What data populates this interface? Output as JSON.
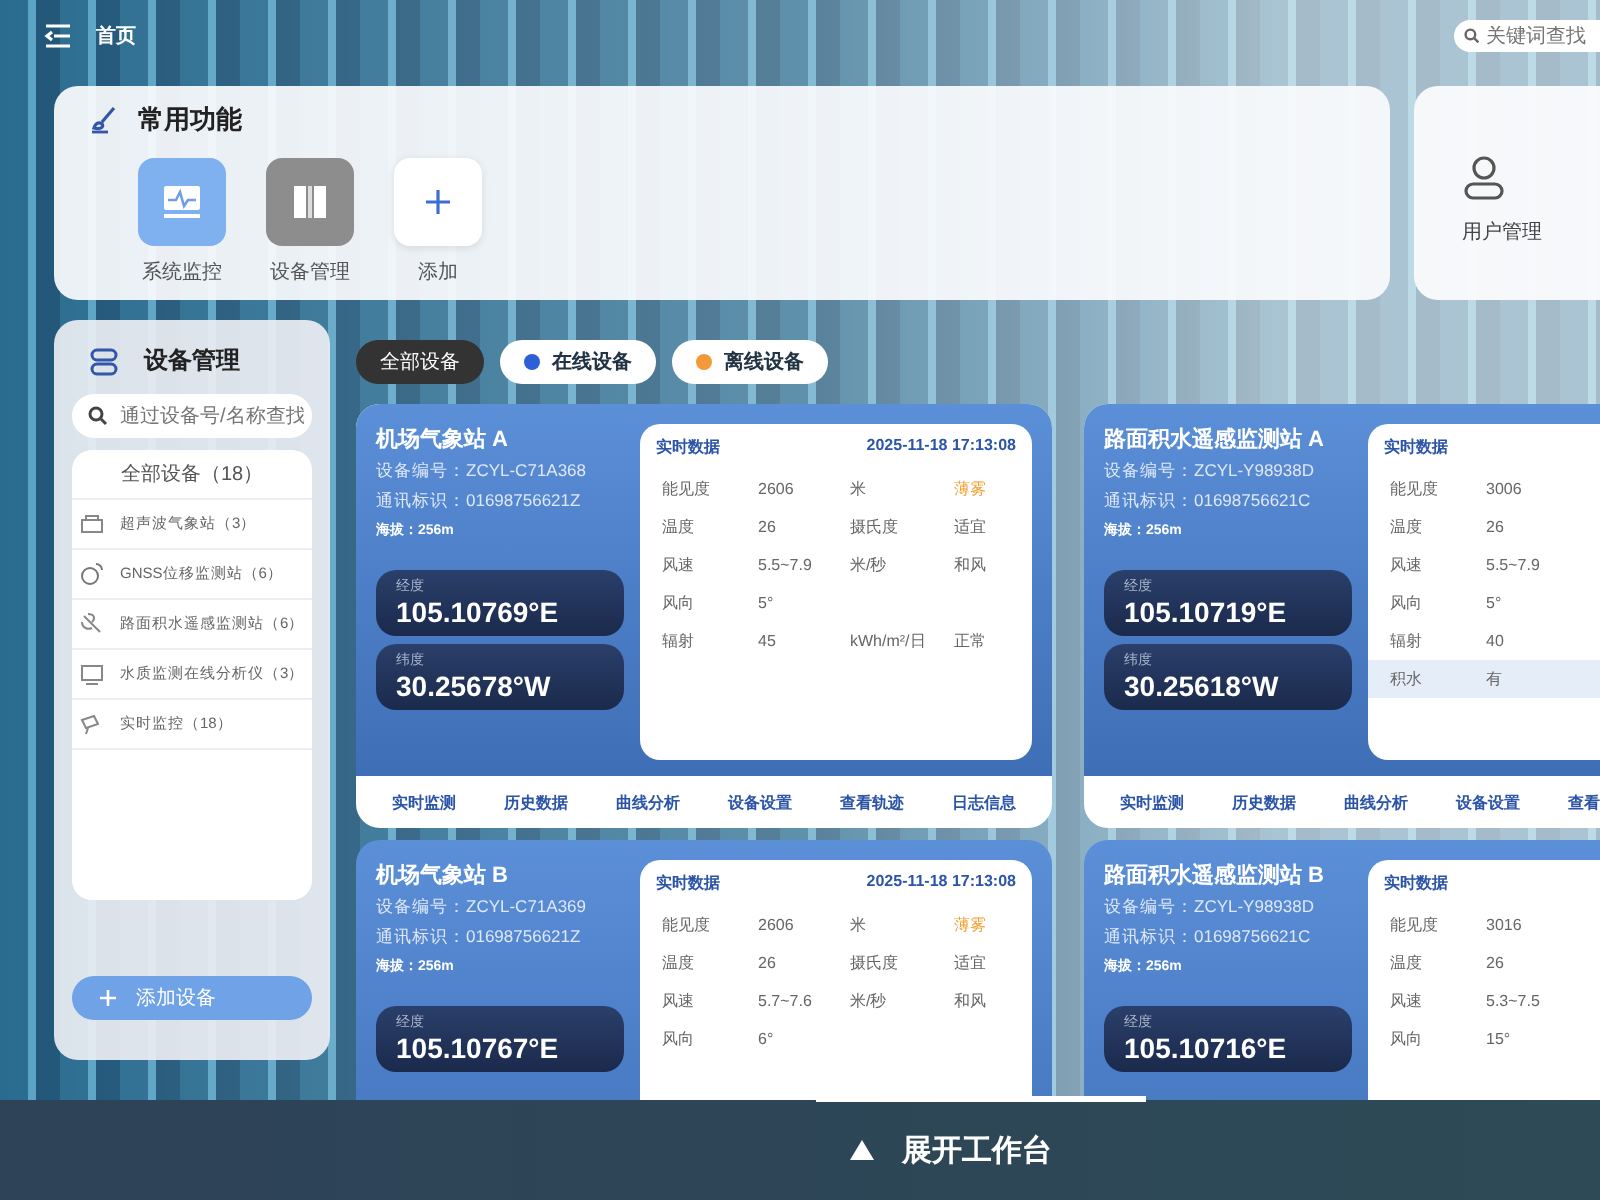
{
  "top_bar": {
    "title": "首页",
    "search": {
      "placeholder": "关键词查找"
    }
  },
  "quick_functions": {
    "title": "常用功能",
    "items": [
      {
        "kind": "monitor",
        "label": "系统监控"
      },
      {
        "kind": "device",
        "label": "设备管理"
      },
      {
        "kind": "add",
        "label": "添加"
      }
    ]
  },
  "side_shortcut": {
    "label": "用户管理"
  },
  "device_panel": {
    "title": "设备管理",
    "search": {
      "placeholder": "通过设备号/名称查找"
    },
    "all": "全部设备（18）",
    "items": [
      {
        "kind": "weather",
        "label": "超声波气象站（3）"
      },
      {
        "kind": "gnss",
        "label": "GNSS位移监测站（6）"
      },
      {
        "kind": "water",
        "label": "路面积水遥感监测站（6）"
      },
      {
        "kind": "quality",
        "label": "水质监测在线分析仪（3）"
      },
      {
        "kind": "realtime",
        "label": "实时监控（18）"
      }
    ],
    "add_button": "添加设备"
  },
  "filters": [
    {
      "label": "全部设备",
      "selected": true
    },
    {
      "label": "在线设备",
      "selected": false,
      "color": "#2f5fd6"
    },
    {
      "label": "离线设备",
      "selected": false,
      "color": "#f29a3a"
    }
  ],
  "cards": [
    {
      "name": "机场气象站 A",
      "device_no": "设备编号：ZCYL-C71A368",
      "comm_id": "通讯标识：01698756621Z",
      "altitude": "海拔：256m",
      "coords": [
        {
          "label": "经度",
          "value": "105.10769°E"
        },
        {
          "label": "纬度",
          "value": "30.25678°W"
        }
      ],
      "data_title": "实时数据",
      "time": "2025-11-18 17:13:08",
      "rows": [
        {
          "label": "能见度",
          "value": "2606",
          "unit": "米",
          "status": "薄雾",
          "warning": true,
          "highlight": false
        },
        {
          "label": "温度",
          "value": "26",
          "unit": "摄氏度",
          "status": "适宜",
          "warning": false,
          "highlight": false
        },
        {
          "label": "风速",
          "value": "5.5~7.9",
          "unit": "米/秒",
          "status": "和风",
          "warning": false,
          "highlight": false
        },
        {
          "label": "风向",
          "value": "5°",
          "highlight": false
        },
        {
          "label": "辐射",
          "value": "45",
          "unit": "kWh/m²/日",
          "status": "正常",
          "warning": false,
          "highlight": false
        }
      ],
      "actions": [
        "实时监测",
        "历史数据",
        "曲线分析",
        "设备设置",
        "查看轨迹",
        "日志信息"
      ]
    },
    {
      "name": "路面积水遥感监测站 A",
      "device_no": "设备编号：ZCYL-Y98938D",
      "comm_id": "通讯标识：01698756621C",
      "altitude": "海拔：256m",
      "coords": [
        {
          "label": "经度",
          "value": "105.10719°E"
        },
        {
          "label": "纬度",
          "value": "30.25618°W"
        }
      ],
      "data_title": "实时数据",
      "rows": [
        {
          "label": "能见度",
          "value": "3006",
          "highlight": false
        },
        {
          "label": "温度",
          "value": "26",
          "highlight": false
        },
        {
          "label": "风速",
          "value": "5.5~7.9",
          "highlight": false
        },
        {
          "label": "风向",
          "value": "5°",
          "highlight": false
        },
        {
          "label": "辐射",
          "value": "40",
          "highlight": false
        },
        {
          "label": "积水",
          "value": "有",
          "highlight": true
        }
      ],
      "actions": [
        "实时监测",
        "历史数据",
        "曲线分析",
        "设备设置",
        "查看"
      ]
    },
    {
      "name": "机场气象站 B",
      "device_no": "设备编号：ZCYL-C71A369",
      "comm_id": "通讯标识：01698756621Z",
      "altitude": "海拔：256m",
      "coords": [
        {
          "label": "经度",
          "value": "105.10767°E"
        }
      ],
      "data_title": "实时数据",
      "time": "2025-11-18 17:13:08",
      "rows": [
        {
          "label": "能见度",
          "value": "2606",
          "unit": "米",
          "status": "薄雾",
          "warning": true,
          "highlight": false
        },
        {
          "label": "温度",
          "value": "26",
          "unit": "摄氏度",
          "status": "适宜",
          "warning": false,
          "highlight": false
        },
        {
          "label": "风速",
          "value": "5.7~7.6",
          "unit": "米/秒",
          "status": "和风",
          "warning": false,
          "highlight": false
        },
        {
          "label": "风向",
          "value": "6°",
          "highlight": false
        }
      ]
    },
    {
      "name": "路面积水遥感监测站 B",
      "device_no": "设备编号：ZCYL-Y98938D",
      "comm_id": "通讯标识：01698756621C",
      "altitude": "海拔：256m",
      "coords": [
        {
          "label": "经度",
          "value": "105.10716°E"
        }
      ],
      "data_title": "实时数据",
      "rows": [
        {
          "label": "能见度",
          "value": "3016",
          "highlight": false
        },
        {
          "label": "温度",
          "value": "26",
          "highlight": false
        },
        {
          "label": "风速",
          "value": "5.3~7.5",
          "highlight": false
        },
        {
          "label": "风向",
          "value": "15°",
          "highlight": false
        }
      ]
    }
  ],
  "workbench": {
    "label": "展开工作台"
  }
}
